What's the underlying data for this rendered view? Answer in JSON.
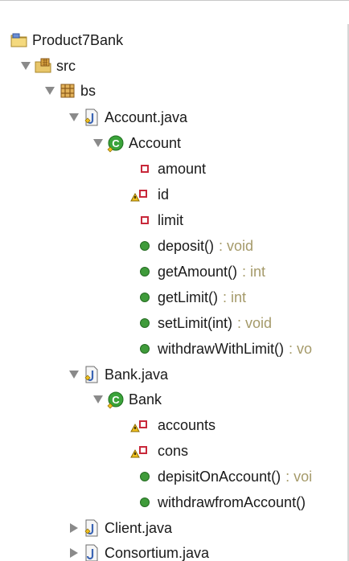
{
  "project": {
    "name": "Product7Bank",
    "icon": "project-folder-icon"
  },
  "src": {
    "name": "src",
    "icon": "source-folder-icon"
  },
  "package": {
    "name": "bs",
    "icon": "package-icon"
  },
  "files": [
    {
      "name": "Account.java",
      "expanded": true,
      "class": {
        "name": "Account",
        "members": [
          {
            "name": "amount",
            "kind": "private-field"
          },
          {
            "name": "id",
            "kind": "private-field-warning"
          },
          {
            "name": "limit",
            "kind": "private-field"
          },
          {
            "name": "deposit()",
            "return": ": void",
            "kind": "public-method"
          },
          {
            "name": "getAmount()",
            "return": ": int",
            "kind": "public-method"
          },
          {
            "name": "getLimit()",
            "return": ": int",
            "kind": "public-method"
          },
          {
            "name": "setLimit(int)",
            "return": ": void",
            "kind": "public-method"
          },
          {
            "name": "withdrawWithLimit()",
            "return": ": vo",
            "kind": "public-method"
          }
        ]
      }
    },
    {
      "name": "Bank.java",
      "expanded": true,
      "class": {
        "name": "Bank",
        "members": [
          {
            "name": "accounts",
            "kind": "private-field-warning"
          },
          {
            "name": "cons",
            "kind": "private-field-warning"
          },
          {
            "name": "depisitOnAccount()",
            "return": ": voi",
            "kind": "public-method"
          },
          {
            "name": "withdrawfromAccount()",
            "return": "",
            "kind": "public-method"
          }
        ]
      }
    },
    {
      "name": "Client.java",
      "expanded": false
    },
    {
      "name": "Consortium.java",
      "expanded": false
    }
  ],
  "colors": {
    "private_field": "#c8283a",
    "public_method": "#3f9b3a",
    "class_icon": "#2e8b2e",
    "return_type": "#a59a6a",
    "warning": "#e0a800"
  }
}
